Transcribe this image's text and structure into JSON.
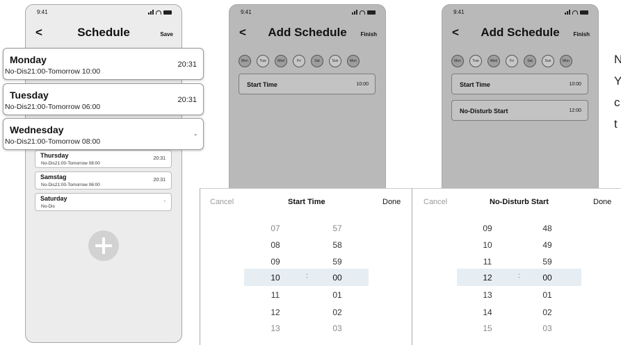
{
  "phone1": {
    "time": "9:41",
    "title": "Schedule",
    "back": "<",
    "action": "Save",
    "cards": [
      {
        "day": "Thursday",
        "sub": "No-Dis21:00-Tomorrow 08:00",
        "time": "20:31"
      },
      {
        "day": "Samstag",
        "sub": "No-Dis21:00-Tomorrow 06:00",
        "time": "20:31"
      },
      {
        "day": "Saturday",
        "sub": "No-Dis",
        "time": "-"
      }
    ],
    "add_icon": "plus-icon"
  },
  "day_cards": [
    {
      "day": "Monday",
      "sub": "No-Dis21:00-Tomorrow 10:00",
      "time": "20:31"
    },
    {
      "day": "Tuesday",
      "sub": "No-Dis21:00-Tomorrow 06:00",
      "time": "20:31"
    },
    {
      "day": "Wednesday",
      "sub": "No-Dis21:00-Tomorrow 08:00",
      "time": "-"
    }
  ],
  "phone2": {
    "time": "9:41",
    "title": "Add Schedule",
    "back": "<",
    "action": "Finish",
    "days": [
      "Mon",
      "Tuw",
      "Wed",
      "Fri",
      "Sat",
      "Sun",
      "Mon"
    ],
    "fields": [
      {
        "label": "Start Time",
        "value": "10:00"
      }
    ]
  },
  "phone3": {
    "time": "9:41",
    "title": "Add Schedule",
    "back": "<",
    "action": "Finish",
    "days": [
      "Mon",
      "Tuw",
      "Wed",
      "Fri",
      "Sat",
      "Sun",
      "Mon"
    ],
    "fields": [
      {
        "label": "Start Time",
        "value": "10:00"
      },
      {
        "label": "No-Disturb Start",
        "value": "12:00"
      }
    ]
  },
  "picker1": {
    "cancel": "Cancel",
    "title": "Start Time",
    "done": "Done",
    "separator": ":",
    "hours": [
      "07",
      "08",
      "09",
      "10",
      "11",
      "12",
      "13"
    ],
    "minutes": [
      "57",
      "58",
      "59",
      "00",
      "01",
      "02",
      "03"
    ]
  },
  "picker2": {
    "cancel": "Cancel",
    "title": "No-Disturb Start",
    "done": "Done",
    "separator": ":",
    "hours": [
      "09",
      "10",
      "11",
      "12",
      "13",
      "14",
      "15"
    ],
    "minutes": [
      "48",
      "49",
      "59",
      "00",
      "01",
      "02",
      "03"
    ]
  },
  "side_text": [
    "N",
    "Y",
    "c",
    "t"
  ]
}
